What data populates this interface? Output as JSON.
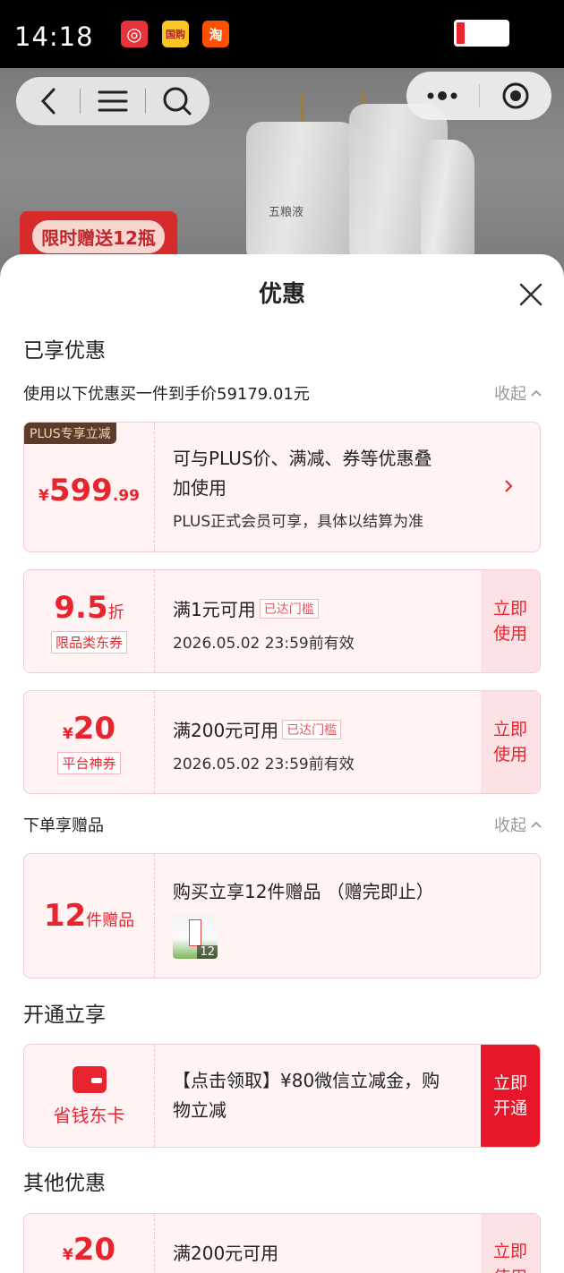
{
  "status_bar": {
    "time": "14:18",
    "app_icons": [
      {
        "name": "netease-music-icon",
        "glyph": "◎",
        "bg": "#e8323c",
        "color": "#fff"
      },
      {
        "name": "tmall-icon",
        "glyph": "国购",
        "bg": "#f9c624",
        "color": "#b22222"
      },
      {
        "name": "taobao-icon",
        "glyph": "淘",
        "bg": "#ff5000",
        "color": "#fff"
      }
    ]
  },
  "background": {
    "promo_tag": "限时赠送12瓶",
    "bottle_brand": "五粮液"
  },
  "sheet": {
    "title": "优惠",
    "enjoyed_section": {
      "title": "已享优惠",
      "summary": "使用以下优惠买一件到手价59179.01元",
      "collapse_label": "收起"
    },
    "plus_card": {
      "badge": "PLUS专享立减",
      "currency": "¥",
      "amount_int": "599",
      "amount_dec": ".99",
      "line1": "可与PLUS价、满减、券等优惠叠",
      "line2": "加使用",
      "note": "PLUS正式会员可享，具体以结算为准"
    },
    "coupons": [
      {
        "value": "9.5",
        "unit": "折",
        "label": "限品类东券",
        "condition": "满1元可用",
        "reached": "已达门槛",
        "validity": "2026.05.02 23:59前有效",
        "action_line1": "立即",
        "action_line2": "使用"
      },
      {
        "currency": "¥",
        "value": "20",
        "label": "平台神券",
        "condition": "满200元可用",
        "reached": "已达门槛",
        "validity": "2026.05.02 23:59前有效",
        "action_line1": "立即",
        "action_line2": "使用"
      }
    ],
    "gift_section": {
      "title": "下单享赠品",
      "collapse_label": "收起",
      "count": "12",
      "unit": "件赠品",
      "desc": "购买立享12件赠品 （赠完即止）",
      "thumb_count": "12"
    },
    "open_section": {
      "title": "开通立享",
      "card_name": "省钱东卡",
      "desc_line1": "【点击领取】¥80微信立减金，购",
      "desc_line2": "物立减",
      "action_line1": "立即",
      "action_line2": "开通"
    },
    "other_section": {
      "title": "其他优惠",
      "currency": "¥",
      "value": "20",
      "condition": "满200元可用",
      "action_line1": "立即",
      "action_line2": "使用"
    }
  },
  "colors": {
    "accent": "#e8242e",
    "card_bg": "#fff3f4",
    "card_border": "#f4cbcf"
  }
}
